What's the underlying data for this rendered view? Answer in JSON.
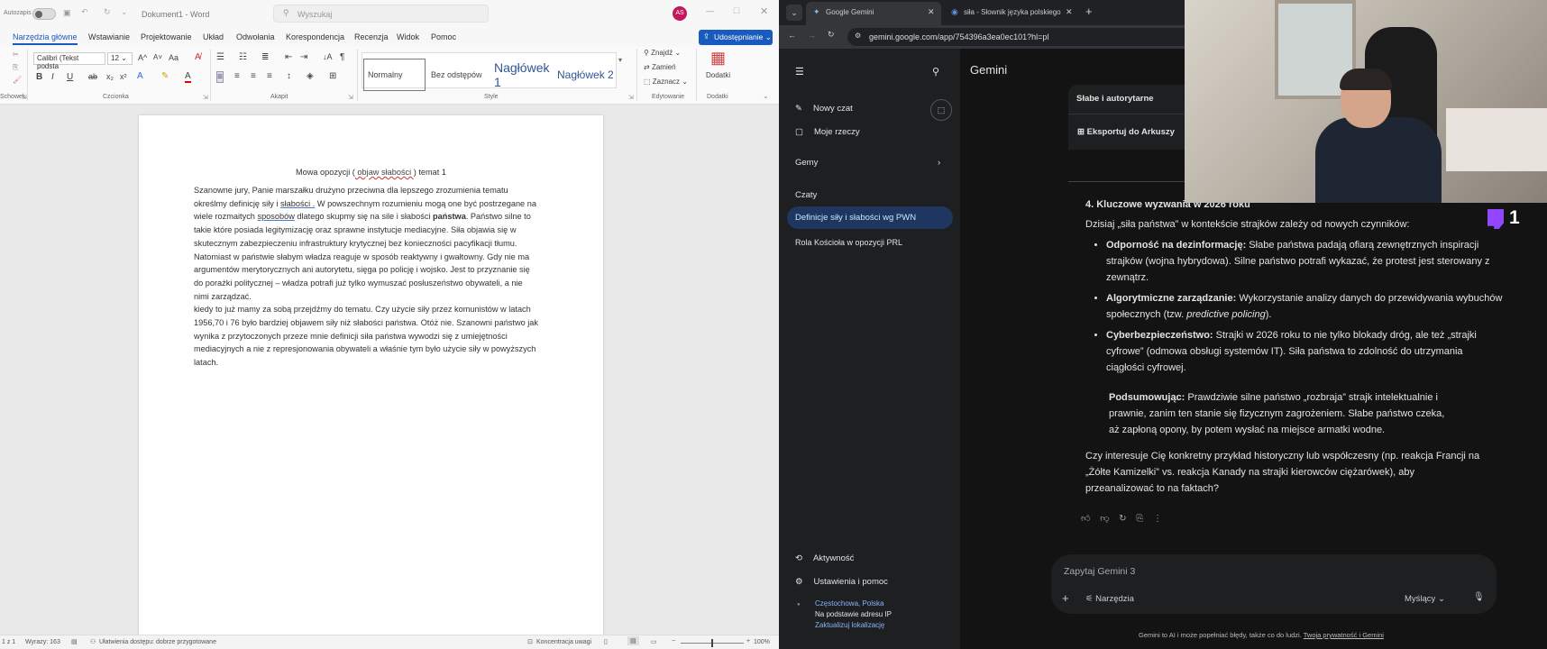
{
  "word": {
    "autosave_label": "Autozapis",
    "doc_title": "Dokument1 - Word",
    "search_placeholder": "Wyszukaj",
    "user_initials": "AS",
    "tabs": [
      "Narzędzia główne",
      "Wstawianie",
      "Projektowanie",
      "Układ",
      "Odwołania",
      "Korespondencja",
      "Recenzja",
      "Widok",
      "Pomoc"
    ],
    "share_label": "Udostępnianie",
    "font_name": "Calibri (Tekst podsta",
    "font_size": "12",
    "groups": [
      "Schowek",
      "Czcionka",
      "Akapit",
      "Style",
      "Edytowanie",
      "Dodatki"
    ],
    "styles": [
      "Normalny",
      "Bez odstępów",
      "Nagłówek 1",
      "Nagłówek 2"
    ],
    "edit_find": "Znajdź",
    "edit_replace": "Zamień",
    "edit_select": "Zaznacz",
    "addins_label": "Dodatki",
    "doc": {
      "title_before": "Mowa opozycji (",
      "title_link": " objaw słabości ",
      "title_after": ") temat 1",
      "p1_a": "Szanowne jury, Panie marszałku drużyno przeciwna dla lepszego zrozumienia tematu",
      "p1_b": "określmy definicję siły i ",
      "p1_b_link": "słabości .",
      "p1_b_rest": " W powszechnym rozumieniu mogą one być postrzegane na",
      "p1_c": "wiele rozmaitych ",
      "p1_c_link": "sposobów",
      "p1_c_rest": " dlatego skupmy się na sile i słabości ",
      "p1_c_bold": "państwa",
      "p1_c_end": ". Państwo silne to",
      "p1_d": "takie które posiada legitymizację oraz sprawne instytucje mediacyjne. Siła objawia się w",
      "p1_e": "skutecznym zabezpieczeniu infrastruktury krytycznej bez konieczności pacyfikacji tłumu.",
      "p1_f": "Natomiast w państwie słabym władza reaguje w sposób reaktywny i gwałtowny. Gdy nie ma",
      "p1_g": "argumentów merytorycznych ani autorytetu, sięga po policję i wojsko. Jest to przyznanie się",
      "p1_h": "do porażki politycznej – władza potrafi już tylko wymuszać posłuszeństwo obywateli, a nie",
      "p1_i": "nimi zarządzać.",
      "p2_a": "kiedy to już mamy za sobą przejdźmy do tematu. Czy użycie siły przez komunistów w latach",
      "p2_b": "1956,70 i 76 było bardziej objawem siły niż słabości państwa. Otóż nie. Szanowni państwo jak",
      "p2_c": "wynika z przytoczonych przeze mnie definicji siła państwa wywodzi się z umiejętności",
      "p2_d": "mediacyjnych a nie z represjonowania obywateli a właśnie tym było użycie siły w powyższych",
      "p2_e": "latach."
    },
    "status": {
      "page": "1 z 1",
      "words": "Wyrazy: 163",
      "accessibility": "Ułatwienia dostępu: dobrze przygotowane",
      "focus": "Koncentracja uwagi",
      "zoom": "100%"
    }
  },
  "chrome": {
    "tab1": "Google Gemini",
    "tab2": "siła - Słownik języka polskiego",
    "url": "gemini.google.com/app/754396a3ea0ec101?hl=pl"
  },
  "gemini": {
    "brand": "Gemini",
    "new_chat": "Nowy czat",
    "my_stuff": "Moje rzeczy",
    "gems": "Gemy",
    "chats": "Czaty",
    "chat_active": "Definicje siły i słabości wg PWN",
    "chat_2": "Rola Kościoła w opozycji PRL",
    "activity": "Aktywność",
    "settings": "Ustawienia i pomoc",
    "location": "Częstochowa, Polska",
    "location_basis": "Na podstawie adresu IP",
    "update_location": "Zaktualizuj lokalizację",
    "table_header": "Słabe i autorytarne",
    "export_label": "Eksportuj do Arkuszy",
    "section_title": "4. Kluczowe wyzwania w 2026 roku",
    "intro": "Dzisiaj „siła państwa” w kontekście strajków zależy od nowych czynników:",
    "bullets": [
      {
        "bold": "Odporność na dezinformację:",
        "text": " Słabe państwa padają ofiarą zewnętrznych inspiracji strajków (wojna hybrydowa). Silne państwo potrafi wykazać, że protest jest sterowany z zewnątrz."
      },
      {
        "bold": "Algorytmiczne zarządzanie:",
        "text": " Wykorzystanie analizy danych do przewidywania wybuchów społecznych (tzw. ",
        "italic": "predictive policing",
        "end": ")."
      },
      {
        "bold": "Cyberbezpieczeństwo:",
        "text": " Strajki w 2026 roku to nie tylko blokady dróg, ale też „strajki cyfrowe” (odmowa obsługi systemów IT). Siła państwa to zdolność do utrzymania ciągłości cyfrowej."
      }
    ],
    "summary_bold": "Podsumowując:",
    "summary_text": " Prawdziwie silne państwo „rozbraja” strajk intelektualnie i prawnie, zanim ten stanie się fizycznym zagrożeniem. Słabe państwo czeka, aż zapłoną opony, by potem wysłać na miejsce armatki wodne.",
    "question": "Czy interesuje Cię konkretny przykład historyczny lub współczesny (np. reakcja Francji na „Żółte Kamizelki” vs. reakcja Kanady na strajki kierowców ciężarówek), aby przeanalizować to na faktach?",
    "input_placeholder": "Zapytaj Gemini 3",
    "tools": "Narzędzia",
    "mode": "Myślący",
    "disclaimer": "Gemini to AI i może popełniać błędy, także co do ludzi.",
    "privacy_link": "Twoja prywatność i Gemini"
  },
  "overlay": {
    "viewer_count": "1",
    "twitch_color": "#9146ff"
  }
}
